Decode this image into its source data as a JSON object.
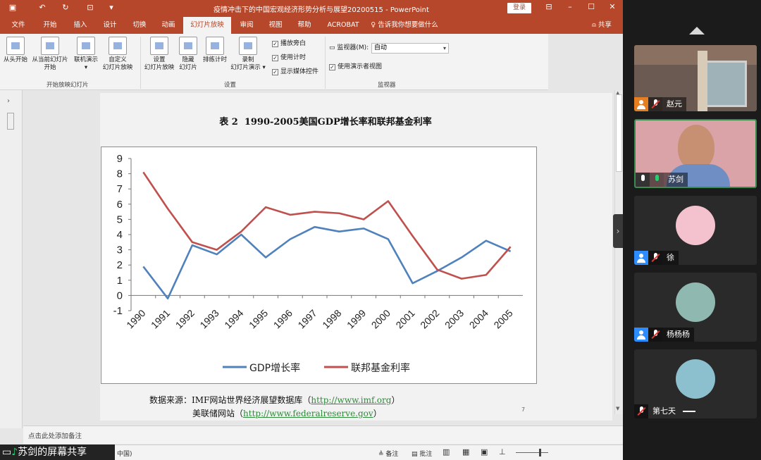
{
  "app": {
    "doc_title": "疫情冲击下的中国宏观经济形势分析与展望20200515 - PowerPoint",
    "login_label": "登录",
    "share_label": "共享",
    "tell_me": "告诉我你想要做什么",
    "tabs": [
      "文件",
      "开始",
      "插入",
      "设计",
      "切换",
      "动画",
      "幻灯片放映",
      "审阅",
      "视图",
      "帮助",
      "ACROBAT"
    ],
    "active_tab": "幻灯片放映"
  },
  "ribbon": {
    "btn_from_start": "从头开始",
    "btn_from_current_1": "从当前幻灯片",
    "btn_from_current_2": "开始",
    "btn_online": "联机演示",
    "btn_custom_1": "自定义",
    "btn_custom_2": "幻灯片放映",
    "group_start": "开始放映幻灯片",
    "btn_setup_1": "设置",
    "btn_setup_2": "幻灯片放映",
    "btn_hide_1": "隐藏",
    "btn_hide_2": "幻灯片",
    "btn_rehearse": "排练计时",
    "btn_record_1": "录制",
    "btn_record_2": "幻灯片演示",
    "chk_narration": "播放旁白",
    "chk_timings": "使用计时",
    "chk_media": "显示媒体控件",
    "group_setup": "设置",
    "monitor_label": "监视器(M):",
    "monitor_value": "自动",
    "chk_presenter_view": "使用演示者视图",
    "group_monitor": "监视器"
  },
  "slide": {
    "title": "表 2  1990-2005美国GDP增长率和联邦基金利率",
    "source_prefix": "数据来源：IMF网站世界经济展望数据库（",
    "source_link1": "http://www.imf.org",
    "source_suffix1": "）",
    "source_line2_prefix": "美联储网站（",
    "source_link2": "http://www.federalreserve.gov",
    "source_suffix2": "）",
    "page_number": "7"
  },
  "chart_data": {
    "type": "line",
    "x": [
      "1990",
      "1991",
      "1992",
      "1993",
      "1994",
      "1995",
      "1996",
      "1997",
      "1998",
      "1999",
      "2000",
      "2001",
      "2002",
      "2003",
      "2004",
      "2005"
    ],
    "ylim": [
      -1,
      9
    ],
    "yticks": [
      "9",
      "8",
      "7",
      "6",
      "5",
      "4",
      "3",
      "2",
      "1",
      "0",
      "-1"
    ],
    "series": [
      {
        "name": "GDP增长率",
        "color": "#4f81bd",
        "values": [
          1.9,
          -0.2,
          3.3,
          2.7,
          4.0,
          2.5,
          3.7,
          4.5,
          4.2,
          4.4,
          3.7,
          0.8,
          1.6,
          2.5,
          3.6,
          2.9
        ]
      },
      {
        "name": "联邦基金利率",
        "color": "#c0504d",
        "values": [
          8.1,
          5.7,
          3.5,
          3.0,
          4.2,
          5.8,
          5.3,
          5.5,
          5.4,
          5.0,
          6.2,
          3.9,
          1.7,
          1.1,
          1.35,
          3.2
        ]
      }
    ],
    "legend": "bottom",
    "grid": false
  },
  "notes": {
    "placeholder": "点击此处添加备注"
  },
  "status": {
    "lang": "中国)",
    "notes_btn": "备注",
    "comments_btn": "批注"
  },
  "share_banner": "苏剑的屏幕共享",
  "participants": [
    {
      "name": "赵元"
    },
    {
      "name": "苏剑"
    },
    {
      "name": "徐"
    },
    {
      "name": "杨杨杨"
    },
    {
      "name": "第七天"
    }
  ]
}
